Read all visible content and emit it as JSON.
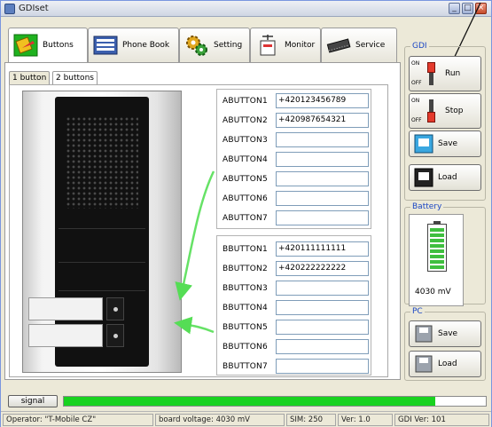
{
  "window": {
    "title": "GDIset"
  },
  "nav_tabs": [
    {
      "label": "Buttons",
      "icon": "buttons-icon",
      "active": true
    },
    {
      "label": "Phone Book",
      "icon": "phone-book-icon",
      "active": false
    },
    {
      "label": "Setting",
      "icon": "gears-icon",
      "active": false
    },
    {
      "label": "Monitor",
      "icon": "monitor-antenna-icon",
      "active": false
    },
    {
      "label": "Service",
      "icon": "chip-icon",
      "active": false
    }
  ],
  "sub_tabs": [
    {
      "label": "1 button",
      "active": false
    },
    {
      "label": "2 buttons",
      "active": true
    }
  ],
  "abuttons": [
    {
      "label": "ABUTTON1",
      "value": "+420123456789"
    },
    {
      "label": "ABUTTON2",
      "value": "+420987654321"
    },
    {
      "label": "ABUTTON3",
      "value": ""
    },
    {
      "label": "ABUTTON4",
      "value": ""
    },
    {
      "label": "ABUTTON5",
      "value": ""
    },
    {
      "label": "ABUTTON6",
      "value": ""
    },
    {
      "label": "ABUTTON7",
      "value": ""
    }
  ],
  "bbuttons": [
    {
      "label": "BBUTTON1",
      "value": "+420111111111"
    },
    {
      "label": "BBUTTON2",
      "value": "+420222222222"
    },
    {
      "label": "BBUTTON3",
      "value": ""
    },
    {
      "label": "BBUTTON4",
      "value": ""
    },
    {
      "label": "BBUTTON5",
      "value": ""
    },
    {
      "label": "BBUTTON6",
      "value": ""
    },
    {
      "label": "BBUTTON7",
      "value": ""
    }
  ],
  "gdi": {
    "legend": "GDI",
    "run_label": "Run",
    "stop_label": "Stop",
    "save_label": "Save",
    "load_label": "Load",
    "switch_on": "ON",
    "switch_off": "OFF"
  },
  "battery": {
    "legend": "Battery",
    "voltage": "4030 mV",
    "level": 0.9,
    "color": "#3fbf3f"
  },
  "pc": {
    "legend": "PC",
    "save_label": "Save",
    "load_label": "Load"
  },
  "signal_label": "signal",
  "signal_level": 0.88,
  "status": {
    "operator": "Operator: \"T-Mobile CZ\"",
    "voltage": "board voltage: 4030 mV",
    "sim": "SIM: 250",
    "ver": "Ver: 1.0",
    "gdi_ver": "GDI Ver: 101"
  }
}
